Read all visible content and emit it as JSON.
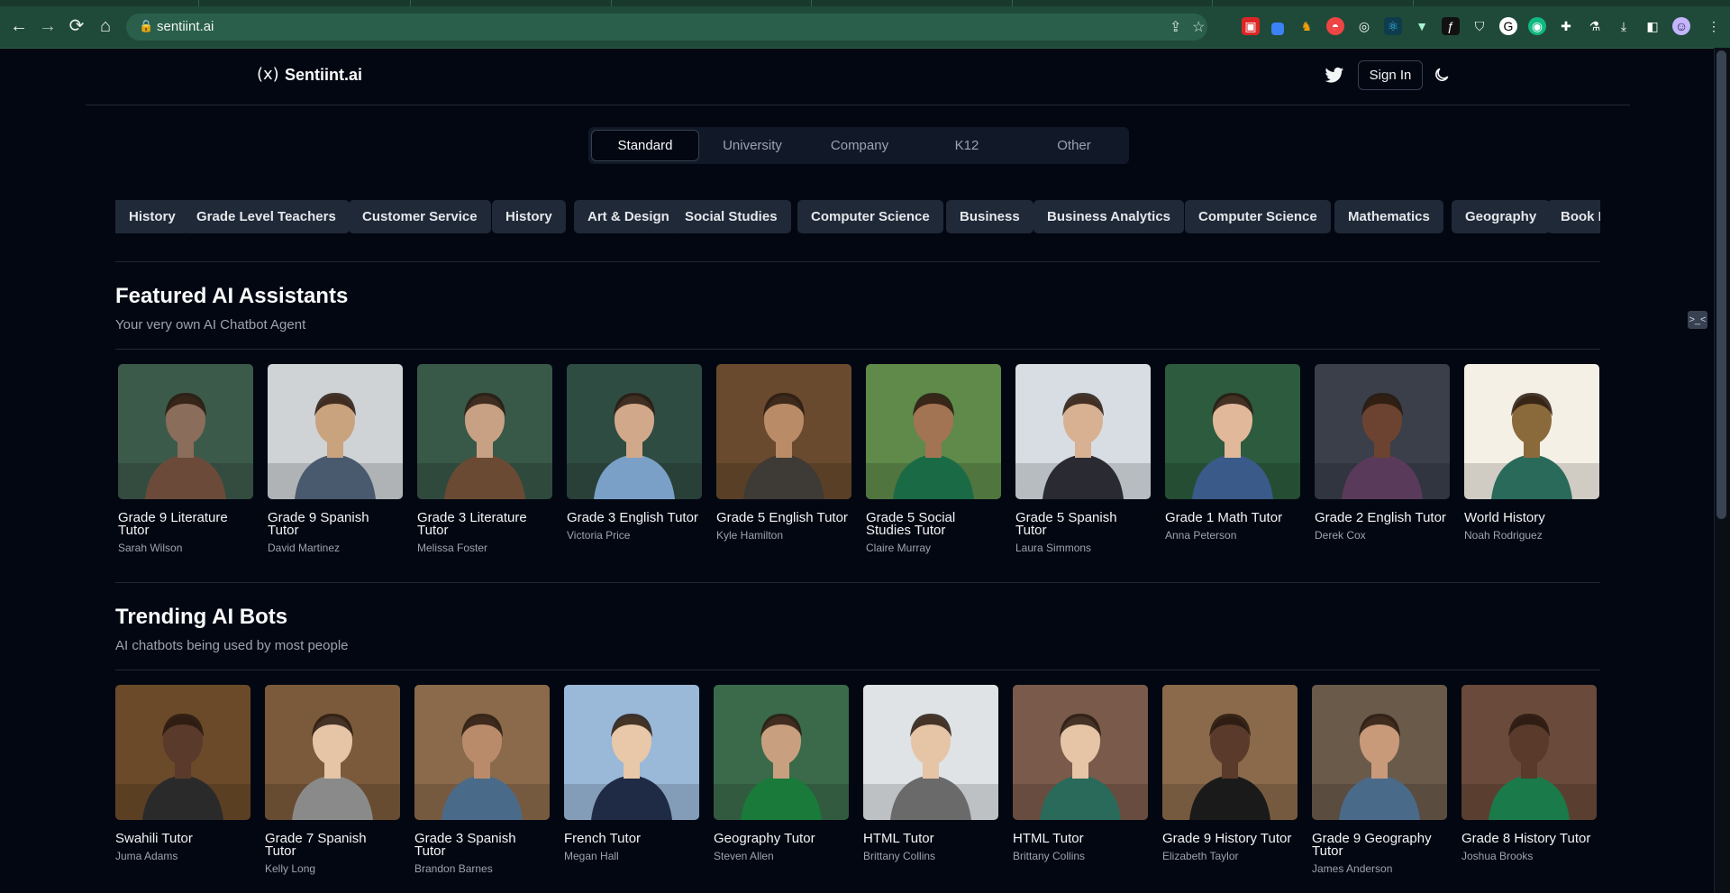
{
  "browser": {
    "url": "sentiint.ai",
    "nav": {
      "back": "←",
      "forward": "→",
      "reload": "⟳",
      "home": "⌂"
    }
  },
  "site": {
    "logo_mark": "(x)",
    "logo_text": "Sentiint.ai",
    "sign_in": "Sign In"
  },
  "segments": [
    {
      "label": "Standard",
      "active": true
    },
    {
      "label": "University",
      "active": false
    },
    {
      "label": "Company",
      "active": false
    },
    {
      "label": "K12",
      "active": false
    },
    {
      "label": "Other",
      "active": false
    }
  ],
  "chips": [
    "History",
    "Grade Level Teachers",
    "Customer Service",
    "History",
    "Art & Design",
    "Social Studies",
    "Computer Science",
    "Business",
    "Business Analytics",
    "Computer Science",
    "Mathematics",
    "Geography",
    "Book Reviews"
  ],
  "featured": {
    "title": "Featured AI Assistants",
    "subtitle": "Your very own AI Chatbot Agent",
    "items": [
      {
        "title": "Grade 9 Literature Tutor",
        "author": "Sarah Wilson"
      },
      {
        "title": "Grade 9 Spanish Tutor",
        "author": "David Martinez"
      },
      {
        "title": "Grade 3 Literature Tutor",
        "author": "Melissa Foster"
      },
      {
        "title": "Grade 3 English Tutor",
        "author": "Victoria Price"
      },
      {
        "title": "Grade 5 English Tutor",
        "author": "Kyle Hamilton"
      },
      {
        "title": "Grade 5 Social Studies Tutor",
        "author": "Claire Murray"
      },
      {
        "title": "Grade 5 Spanish Tutor",
        "author": "Laura Simmons"
      },
      {
        "title": "Grade 1 Math Tutor",
        "author": "Anna Peterson"
      },
      {
        "title": "Grade 2 English Tutor",
        "author": "Derek Cox"
      },
      {
        "title": "World History",
        "author": "Noah Rodriguez"
      }
    ]
  },
  "trending": {
    "title": "Trending AI Bots",
    "subtitle": "AI chatbots being used by most people",
    "items": [
      {
        "title": "Swahili Tutor",
        "author": "Juma Adams"
      },
      {
        "title": "Grade 7 Spanish Tutor",
        "author": "Kelly Long"
      },
      {
        "title": "Grade 3 Spanish Tutor",
        "author": "Brandon Barnes"
      },
      {
        "title": "French Tutor",
        "author": "Megan Hall"
      },
      {
        "title": "Geography Tutor",
        "author": "Steven Allen"
      },
      {
        "title": "HTML Tutor",
        "author": "Brittany Collins"
      },
      {
        "title": "HTML Tutor",
        "author": "Brittany Collins"
      },
      {
        "title": "Grade 9 History Tutor",
        "author": "Elizabeth Taylor"
      },
      {
        "title": "Grade 9 Geography Tutor",
        "author": "James Anderson"
      },
      {
        "title": "Grade 8 History Tutor",
        "author": "Joshua Brooks"
      }
    ]
  },
  "colors": {
    "page_bg": "#030712",
    "chip_bg": "#1f2937",
    "chrome_bg": "#1f4a3a"
  }
}
